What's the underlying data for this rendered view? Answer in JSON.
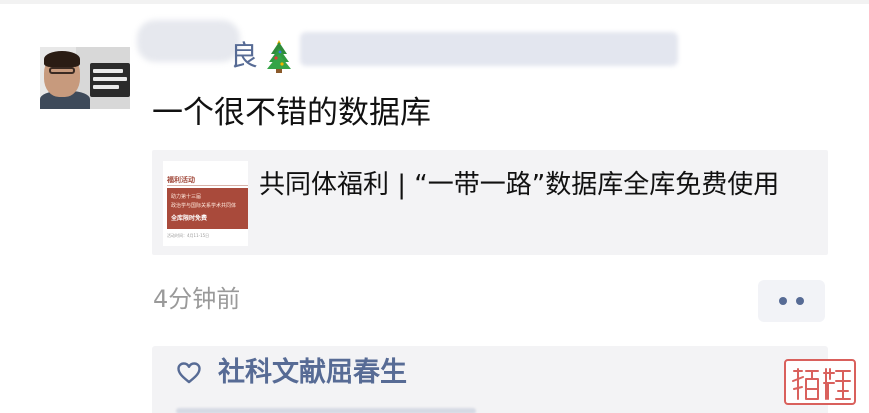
{
  "post": {
    "author_visible_char": "良",
    "author_emoji_icon": "christmas-tree-icon",
    "text": "一个很不错的数据库",
    "timestamp": "4分钟前"
  },
  "link_card": {
    "title": "共同体福利 | “一带一路”数据库全库免费使用",
    "thumbnail": {
      "header": "福利活动",
      "line1": "助力第十三届",
      "line2": "政治学与国际关系学术共同体",
      "line3": "全库限时免费",
      "footer": "活动时间：4月11-15日"
    }
  },
  "likes": {
    "icon": "heart-outline-icon",
    "names": "社科文献屈春生"
  },
  "more_button": {
    "icon": "two-dots-icon"
  },
  "colors": {
    "link_blue": "#576b95",
    "meta_gray": "#9a9a9a",
    "card_bg": "#f3f3f5",
    "watermark_red": "#d9605c"
  }
}
